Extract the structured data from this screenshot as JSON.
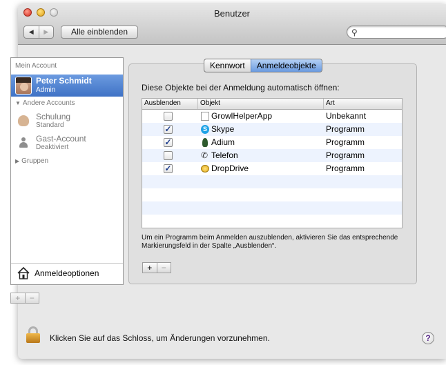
{
  "window": {
    "title": "Benutzer"
  },
  "toolbar": {
    "back_icon": "◀",
    "forward_icon": "▶",
    "show_all_label": "Alle einblenden",
    "search_placeholder": "",
    "search_value": ""
  },
  "sidebar": {
    "my_account_heading": "Mein Account",
    "current_user": {
      "name": "Peter Schmidt",
      "role": "Admin"
    },
    "other_accounts_heading": "Andere Accounts",
    "other_accounts": [
      {
        "name": "Schulung",
        "role": "Standard",
        "icon": "gingerbread-icon"
      },
      {
        "name": "Gast-Account",
        "role": "Deaktiviert",
        "icon": "guest-icon"
      }
    ],
    "groups_heading": "Gruppen",
    "login_options_label": "Anmeldeoptionen",
    "add_label": "+",
    "remove_label": "−"
  },
  "tabs": [
    {
      "label": "Kennwort",
      "selected": false
    },
    {
      "label": "Anmeldeobjekte",
      "selected": true
    }
  ],
  "login_items": {
    "heading": "Diese Objekte bei der Anmeldung automatisch öffnen:",
    "columns": [
      "Ausblenden",
      "Objekt",
      "Art"
    ],
    "rows": [
      {
        "hide": false,
        "name": "GrowlHelperApp",
        "kind": "Unbekannt",
        "icon": "document-icon"
      },
      {
        "hide": true,
        "name": "Skype",
        "kind": "Programm",
        "icon": "skype-icon"
      },
      {
        "hide": true,
        "name": "Adium",
        "kind": "Programm",
        "icon": "adium-icon"
      },
      {
        "hide": false,
        "name": "Telefon",
        "kind": "Programm",
        "icon": "phone-icon"
      },
      {
        "hide": true,
        "name": "DropDrive",
        "kind": "Programm",
        "icon": "dropdrive-icon"
      }
    ],
    "hint": "Um ein Programm beim Anmelden auszublenden, aktivieren Sie das entsprechende Markierungsfeld in der Spalte „Ausblenden“.",
    "add_label": "+",
    "remove_label": "−"
  },
  "footer": {
    "lock_text": "Klicken Sie auf das Schloss, um Änderungen vorzunehmen.",
    "help_label": "?"
  },
  "colors": {
    "selection": "#3f72c5",
    "row_alt": "#edf3fe",
    "tab_selected": "#6a9ae0"
  }
}
